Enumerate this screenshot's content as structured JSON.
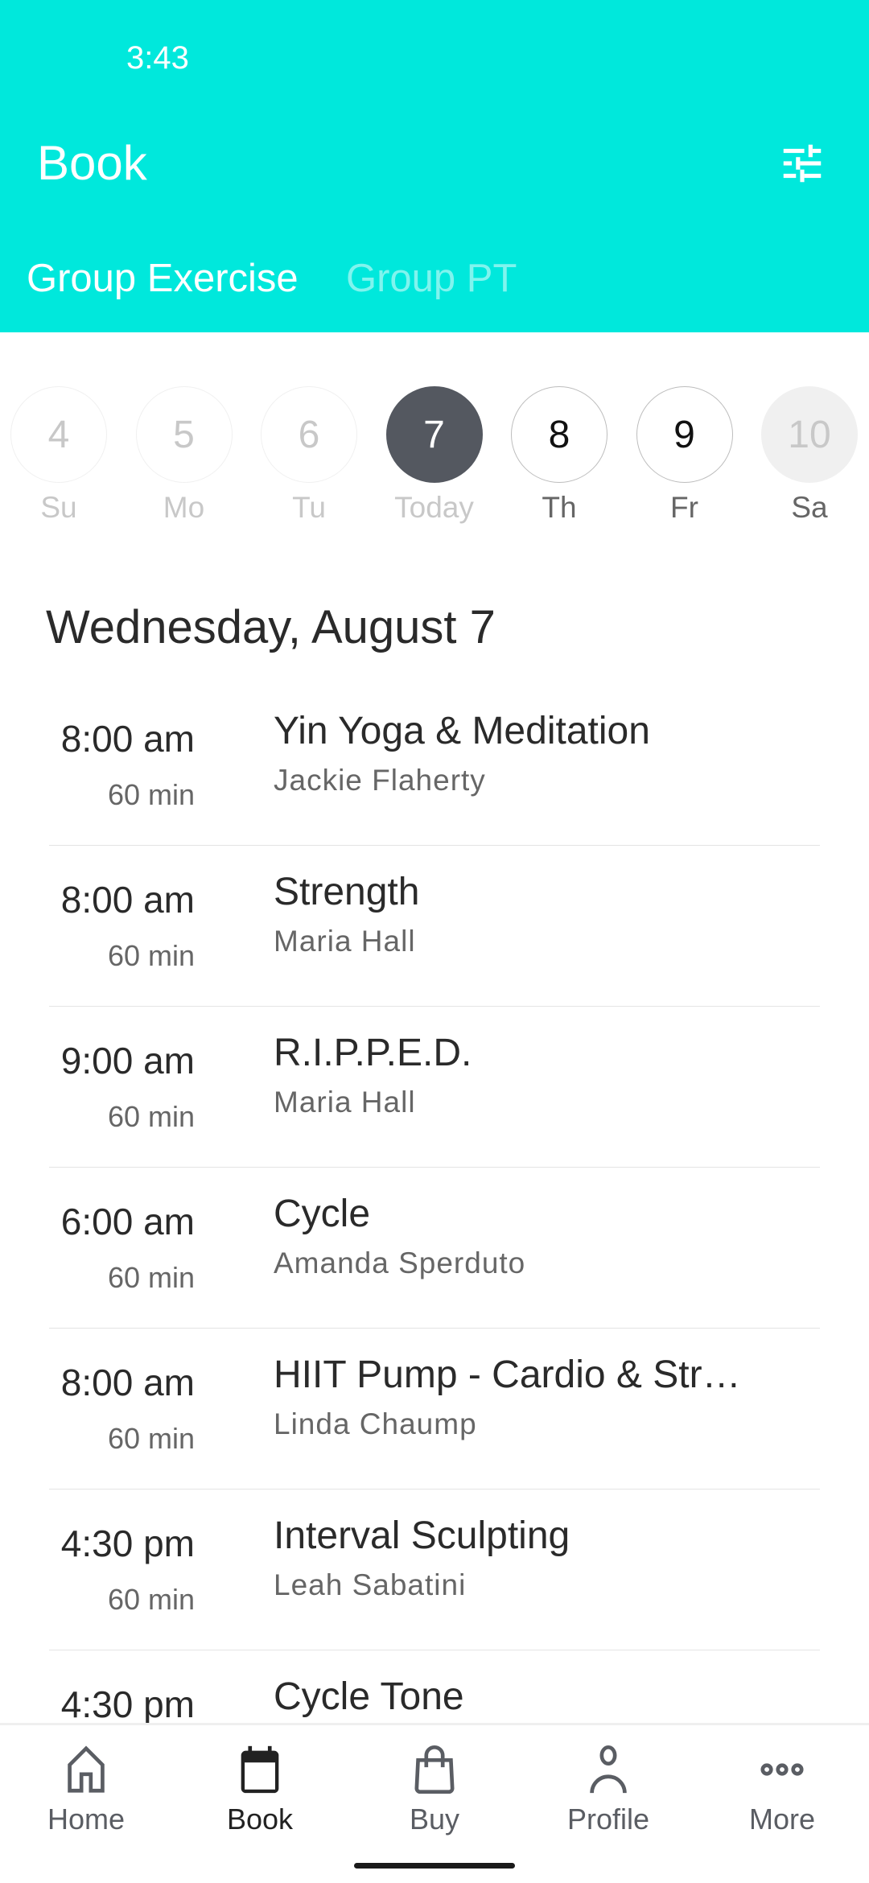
{
  "status_bar": {
    "time": "3:43"
  },
  "header": {
    "title": "Book",
    "filter_icon": "sliders-icon",
    "background": "#00E8DC"
  },
  "tabs": [
    {
      "label": "Group Exercise",
      "active": true
    },
    {
      "label": "Group PT",
      "active": false
    }
  ],
  "days": [
    {
      "num": "4",
      "label": "Su",
      "state": "past"
    },
    {
      "num": "5",
      "label": "Mo",
      "state": "past"
    },
    {
      "num": "6",
      "label": "Tu",
      "state": "past"
    },
    {
      "num": "7",
      "label": "Today",
      "state": "selected"
    },
    {
      "num": "8",
      "label": "Th",
      "state": "future"
    },
    {
      "num": "9",
      "label": "Fr",
      "state": "future"
    },
    {
      "num": "10",
      "label": "Sa",
      "state": "unavailable"
    }
  ],
  "date_heading": "Wednesday, August 7",
  "classes": [
    {
      "time": "8:00 am",
      "duration": "60 min",
      "name": "Yin Yoga & Meditation",
      "instructor": "Jackie Flaherty"
    },
    {
      "time": "8:00 am",
      "duration": "60 min",
      "name": "Strength",
      "instructor": "Maria Hall"
    },
    {
      "time": "9:00 am",
      "duration": "60 min",
      "name": "R.I.P.P.E.D.",
      "instructor": "Maria Hall"
    },
    {
      "time": "6:00 am",
      "duration": "60 min",
      "name": "Cycle",
      "instructor": "Amanda Sperduto"
    },
    {
      "time": "8:00 am",
      "duration": "60 min",
      "name": "HIIT Pump - Cardio & Str…",
      "instructor": "Linda Chaump"
    },
    {
      "time": "4:30 pm",
      "duration": "60 min",
      "name": "Interval Sculpting",
      "instructor": "Leah Sabatini"
    },
    {
      "time": "4:30 pm",
      "duration": "",
      "name": "Cycle Tone",
      "instructor": ""
    }
  ],
  "nav": [
    {
      "label": "Home",
      "icon": "home-icon"
    },
    {
      "label": "Book",
      "icon": "calendar-icon",
      "active": true
    },
    {
      "label": "Buy",
      "icon": "shopping-bag-icon"
    },
    {
      "label": "Profile",
      "icon": "person-icon"
    },
    {
      "label": "More",
      "icon": "more-dots-icon"
    }
  ]
}
